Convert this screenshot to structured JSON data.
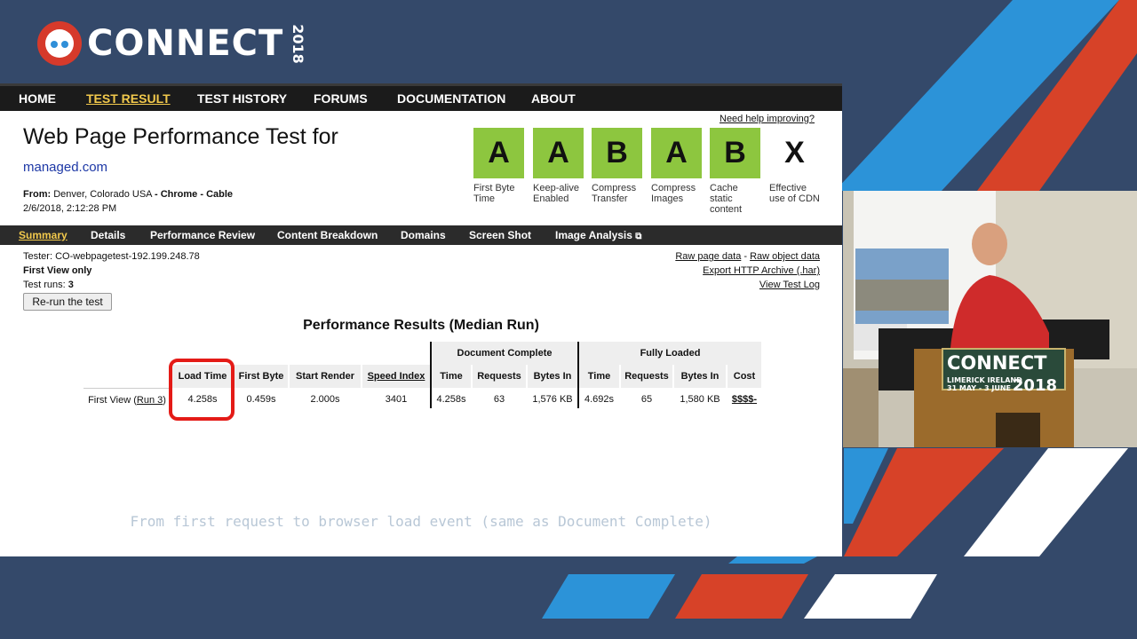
{
  "conference": {
    "name": "CONNECT",
    "year": "2018"
  },
  "topnav": [
    {
      "label": "HOME",
      "active": false
    },
    {
      "label": "TEST RESULT",
      "active": true
    },
    {
      "label": "TEST HISTORY",
      "active": false
    },
    {
      "label": "FORUMS",
      "active": false
    },
    {
      "label": "DOCUMENTATION",
      "active": false
    },
    {
      "label": "ABOUT",
      "active": false
    }
  ],
  "header": {
    "title": "Web Page Performance Test for",
    "site": "managed.com",
    "from_label": "From:",
    "from_value": "Denver, Colorado USA",
    "browser": "Chrome",
    "connection": "Cable",
    "date": "2/6/2018, 2:12:28 PM",
    "help_link": "Need help improving?"
  },
  "grades": [
    {
      "grade": "A",
      "caption": "First Byte Time"
    },
    {
      "grade": "A",
      "caption": "Keep-alive Enabled"
    },
    {
      "grade": "B",
      "caption": "Compress Transfer"
    },
    {
      "grade": "A",
      "caption": "Compress Images"
    },
    {
      "grade": "B",
      "caption": "Cache static content"
    },
    {
      "grade": "X",
      "caption": "Effective use of CDN"
    }
  ],
  "subnav": [
    {
      "label": "Summary",
      "active": true
    },
    {
      "label": "Details",
      "active": false
    },
    {
      "label": "Performance Review",
      "active": false
    },
    {
      "label": "Content Breakdown",
      "active": false
    },
    {
      "label": "Domains",
      "active": false
    },
    {
      "label": "Screen Shot",
      "active": false
    },
    {
      "label": "Image Analysis",
      "active": false
    }
  ],
  "test_info": {
    "tester": "Tester: CO-webpagetest-192.199.248.78",
    "view": "First View only",
    "runs_label": "Test runs:",
    "runs_value": "3",
    "rerun_button": "Re-run the test"
  },
  "right_links": {
    "raw_page": "Raw page data",
    "separator": "-",
    "raw_object": "Raw object data",
    "export_har": "Export HTTP Archive (.har)",
    "view_log": "View Test Log"
  },
  "results": {
    "title": "Performance Results (Median Run)",
    "group_headers": [
      "Document Complete",
      "Fully Loaded"
    ],
    "columns": [
      "Load Time",
      "First Byte",
      "Start Render",
      "Speed Index",
      "Time",
      "Requests",
      "Bytes In",
      "Time",
      "Requests",
      "Bytes In",
      "Cost"
    ],
    "row_label": "First View (",
    "row_link": "Run 3",
    "row_label_end": ")",
    "row": [
      "4.258s",
      "0.459s",
      "2.000s",
      "3401",
      "4.258s",
      "63",
      "1,576 KB",
      "4.692s",
      "65",
      "1,580 KB",
      "$$$$-"
    ]
  },
  "caption": "From first request to browser load event (same as Document Complete)",
  "colors": {
    "grade_green": "#8dc63f",
    "highlight_red": "#e41b17",
    "nav_active": "#f2c94c",
    "link_blue": "#1d38a6"
  },
  "video": {
    "banner": "CONNECT",
    "banner_year": "2018",
    "location": "LIMERICK  IRELAND",
    "dates": "31 MAY - 3 JUNE"
  }
}
